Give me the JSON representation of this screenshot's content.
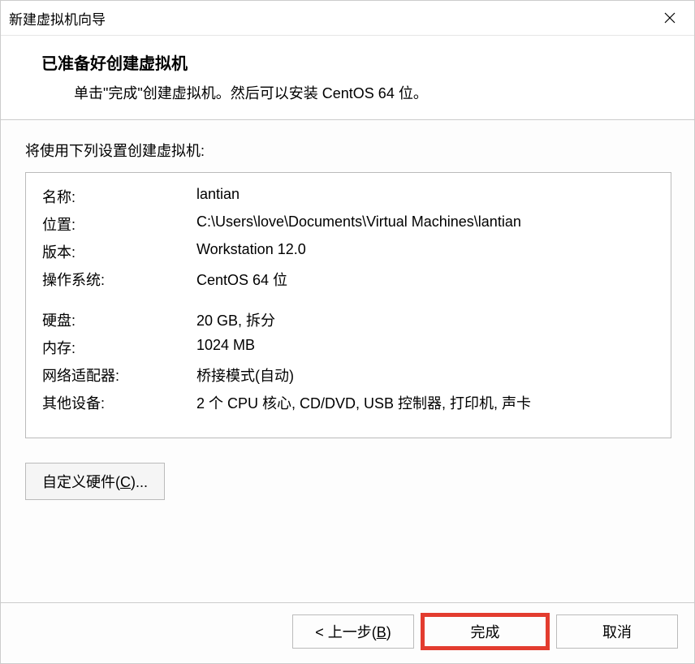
{
  "window": {
    "title": "新建虚拟机向导"
  },
  "header": {
    "title": "已准备好创建虚拟机",
    "subtitle": "单击\"完成\"创建虚拟机。然后可以安装 CentOS 64 位。"
  },
  "content": {
    "intro": "将使用下列设置创建虚拟机:",
    "settings": {
      "name_label": "名称:",
      "name_value": "lantian",
      "location_label": "位置:",
      "location_value": "C:\\Users\\love\\Documents\\Virtual Machines\\lantian",
      "version_label": "版本:",
      "version_value": "Workstation 12.0",
      "os_label": "操作系统:",
      "os_value": "CentOS 64 位",
      "disk_label": "硬盘:",
      "disk_value": "20 GB, 拆分",
      "memory_label": "内存:",
      "memory_value": "1024 MB",
      "network_label": "网络适配器:",
      "network_value": "桥接模式(自动)",
      "other_label": "其他设备:",
      "other_value": "2 个 CPU 核心, CD/DVD, USB 控制器, 打印机, 声卡"
    },
    "customize_prefix": "自定义硬件(",
    "customize_key": "C",
    "customize_suffix": ")..."
  },
  "footer": {
    "back_prefix": "< 上一步(",
    "back_key": "B",
    "back_suffix": ")",
    "finish": "完成",
    "cancel": "取消"
  }
}
